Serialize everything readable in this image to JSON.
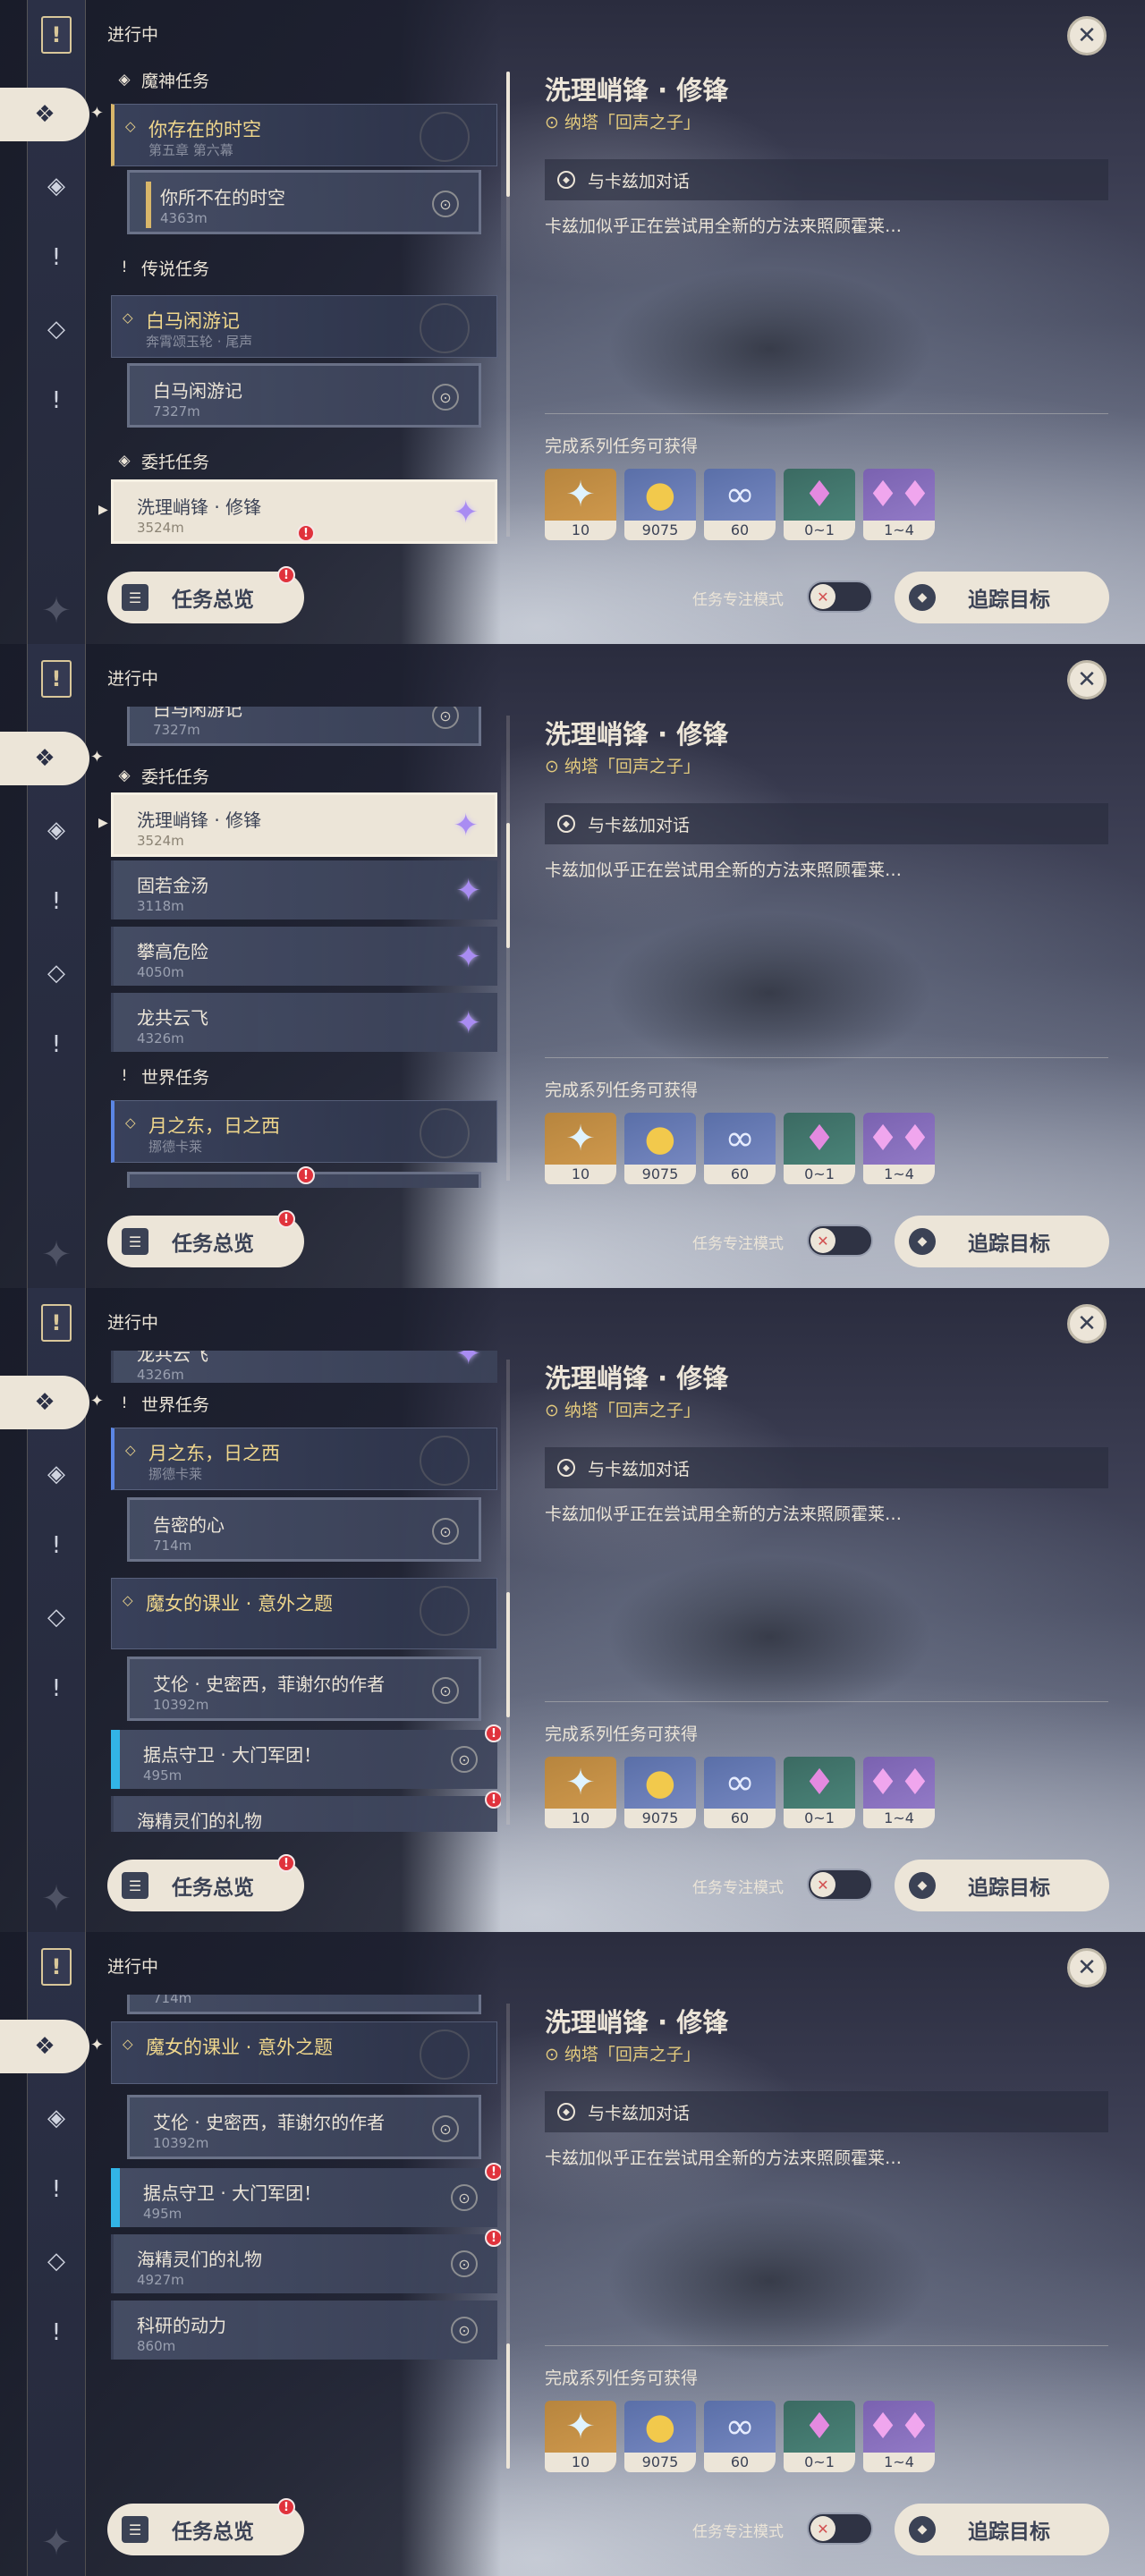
{
  "header": {
    "progress_label": "进行中"
  },
  "sections": {
    "archon": "魔神任务",
    "legend": "传说任务",
    "commission": "委托任务",
    "world": "世界任务"
  },
  "quests": {
    "archon_chain": {
      "title": "你存在的时空",
      "subtitle": "第五章 第六幕"
    },
    "archon_step": {
      "title": "你所不在的时空",
      "distance": "4363m"
    },
    "legend_chain": {
      "title": "白马闲游记",
      "subtitle": "奔霄颂玉轮 · 尾声"
    },
    "legend_step": {
      "title": "白马闲游记",
      "distance": "7327m"
    },
    "commissions": [
      {
        "title": "洗理峭锋 · 修锋",
        "distance": "3524m"
      },
      {
        "title": "固若金汤",
        "distance": "3118m"
      },
      {
        "title": "攀高危险",
        "distance": "4050m"
      },
      {
        "title": "龙共云飞",
        "distance": "4326m"
      }
    ],
    "world_chain_1": {
      "title": "月之东，日之西",
      "subtitle": "挪德卡莱"
    },
    "world_step_1": {
      "title": "告密的心",
      "distance": "714m"
    },
    "world_chain_2": {
      "title": "魔女的课业 · 意外之题"
    },
    "world_step_2": {
      "title": "艾伦 · 史密西，菲谢尔的作者",
      "distance": "10392m"
    },
    "world_quests": [
      {
        "title": "据点守卫 · 大门军团！",
        "distance": "495m"
      },
      {
        "title": "海精灵们的礼物",
        "distance": "4927m"
      },
      {
        "title": "科研的动力",
        "distance": "860m"
      }
    ]
  },
  "detail": {
    "title": "洗理峭锋 · 修锋",
    "location": "纳塔「回声之子」",
    "objective": "与卡兹加对话",
    "description": "卡兹加似乎正在尝试用全新的方法来照顾霍莱…",
    "reward_label": "完成系列任务可获得",
    "rewards": [
      {
        "icon": "primogem-icon",
        "count": "10"
      },
      {
        "icon": "mora-icon",
        "count": "9075"
      },
      {
        "icon": "adventure-exp-icon",
        "count": "60"
      },
      {
        "icon": "crystal-icon",
        "count": "0~1"
      },
      {
        "icon": "crystal-cluster-icon",
        "count": "1~4"
      }
    ]
  },
  "footer": {
    "overview_label": "任务总览",
    "focus_mode_label": "任务专注模式",
    "track_label": "追踪目标"
  },
  "colors": {
    "accent_gold": "#f0d78c",
    "cream": "#ece5d8",
    "alert_red": "#e0323c",
    "commission_purple": "#a98cf2"
  }
}
